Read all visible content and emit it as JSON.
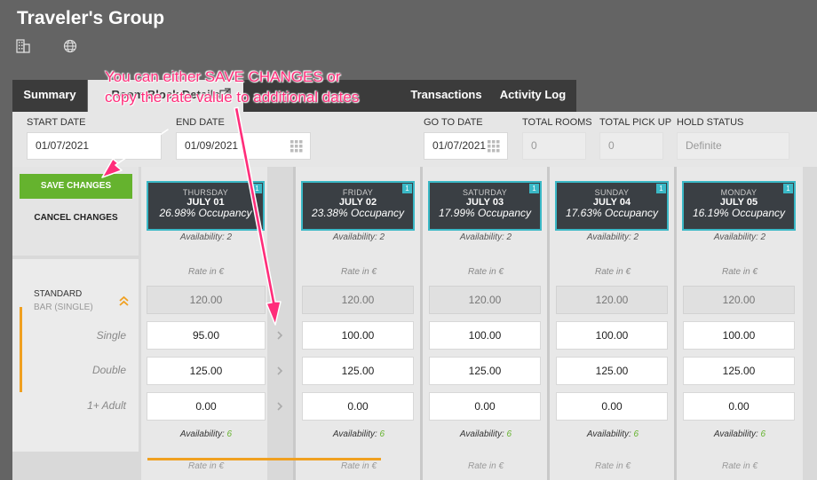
{
  "header": {
    "title": "Traveler's Group"
  },
  "tabs": [
    {
      "label": "Summary"
    },
    {
      "label": "Room Block Details"
    },
    {
      "label": "Transactions"
    },
    {
      "label": "Activity Log"
    }
  ],
  "filters": {
    "start_date": {
      "label": "START DATE",
      "value": "01/07/2021"
    },
    "end_date": {
      "label": "END DATE",
      "value": "01/09/2021"
    },
    "go_to_date": {
      "label": "GO TO DATE",
      "value": "01/07/2021"
    },
    "total_rooms": {
      "label": "TOTAL ROOMS",
      "value": "0"
    },
    "total_pickup": {
      "label": "TOTAL PICK UP",
      "value": "0"
    },
    "hold_status": {
      "label": "HOLD STATUS",
      "value": "Definite"
    }
  },
  "actions": {
    "save": "SAVE CHANGES",
    "cancel": "CANCEL CHANGES"
  },
  "room": {
    "name": "STANDARD",
    "subtitle": "BAR (SINGLE)"
  },
  "row_labels": [
    "Single",
    "Double",
    "1+ Adult"
  ],
  "rate_label": "Rate in €",
  "availability_label": "Availability:",
  "days": [
    {
      "dow": "THURSDAY",
      "date": "JULY 01",
      "occupancy": "26.98% Occupancy",
      "badge": "1",
      "avail_top": "Availability: 2",
      "bar": "120.00",
      "rates": [
        "95.00",
        "125.00",
        "0.00"
      ],
      "availability": "6"
    },
    {
      "dow": "FRIDAY",
      "date": "JULY 02",
      "occupancy": "23.38% Occupancy",
      "badge": "1",
      "avail_top": "Availability: 2",
      "bar": "120.00",
      "rates": [
        "100.00",
        "125.00",
        "0.00"
      ],
      "availability": "6"
    },
    {
      "dow": "SATURDAY",
      "date": "JULY 03",
      "occupancy": "17.99% Occupancy",
      "badge": "1",
      "avail_top": "Availability: 2",
      "bar": "120.00",
      "rates": [
        "100.00",
        "125.00",
        "0.00"
      ],
      "availability": "6"
    },
    {
      "dow": "SUNDAY",
      "date": "JULY 04",
      "occupancy": "17.63% Occupancy",
      "badge": "1",
      "avail_top": "Availability: 2",
      "bar": "120.00",
      "rates": [
        "100.00",
        "125.00",
        "0.00"
      ],
      "availability": "6"
    },
    {
      "dow": "MONDAY",
      "date": "JULY 05",
      "occupancy": "16.19% Occupancy",
      "badge": "1",
      "avail_top": "Availability: 2",
      "bar": "120.00",
      "rates": [
        "100.00",
        "125.00",
        "0.00"
      ],
      "availability": "6"
    }
  ],
  "annotation": {
    "line1": "You can either SAVE CHANGES or",
    "line2": "copy the rate value to additional dates"
  },
  "colors": {
    "accent": "#3ab8c6",
    "save": "#65b32e",
    "annotation": "#ff2d7a",
    "highlight": "#f0a020"
  }
}
